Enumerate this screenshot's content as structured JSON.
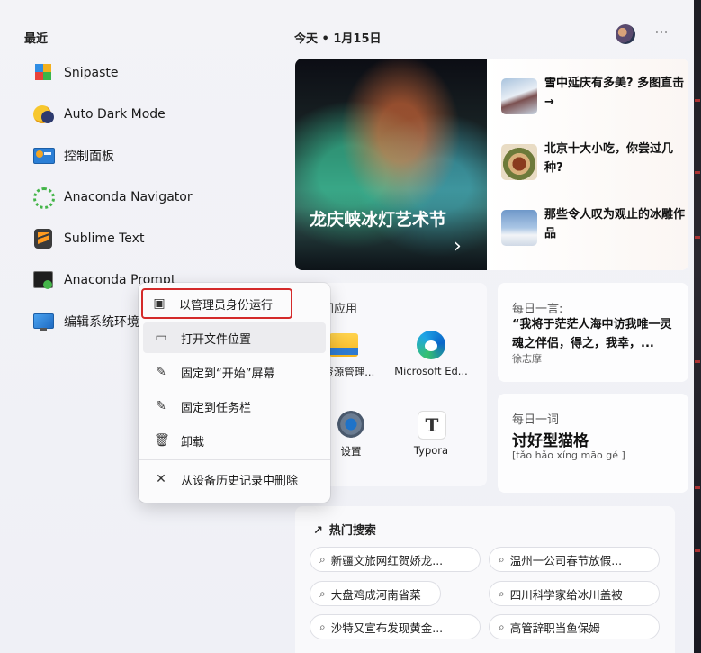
{
  "recent": {
    "title": "最近",
    "items": [
      {
        "label": "Snipaste",
        "icon": "snipaste-icon"
      },
      {
        "label": "Auto Dark Mode",
        "icon": "auto-dark-mode-icon"
      },
      {
        "label": "控制面板",
        "icon": "control-panel-icon"
      },
      {
        "label": "Anaconda Navigator",
        "icon": "anaconda-navigator-icon"
      },
      {
        "label": "Sublime Text",
        "icon": "sublime-text-icon"
      },
      {
        "label": "Anaconda Prompt",
        "icon": "anaconda-prompt-icon"
      },
      {
        "label": "编辑系统环境",
        "icon": "system-environment-icon"
      }
    ]
  },
  "header": {
    "today": "今天 • 1月15日",
    "more": "···"
  },
  "news": {
    "hero_title": "龙庆峡冰灯艺术节",
    "hero_arrow": "›",
    "items": [
      {
        "text": "雪中延庆有多美? 多图直击→"
      },
      {
        "text": "北京十大小吃，你尝过几种?"
      },
      {
        "text": "那些令人叹为观止的冰雕作品"
      }
    ]
  },
  "apps": {
    "title": "门应用",
    "items": [
      {
        "label": "件资源管理...",
        "icon": "file-explorer-icon"
      },
      {
        "label": "Microsoft Ed...",
        "icon": "edge-icon"
      },
      {
        "label": "设置",
        "icon": "settings-gear-icon"
      },
      {
        "label": "Typora",
        "icon": "typora-icon",
        "glyph": "T"
      }
    ]
  },
  "quote": {
    "caption": "每日一言:",
    "text": "“我将于茫茫人海中访我唯一灵魂之伴侣，得之，我幸，...",
    "author": "徐志摩"
  },
  "word": {
    "caption": "每日一词",
    "word": "讨好型猫格",
    "pinyin": "[tǎo hǎo xíng māo gé ]"
  },
  "hot": {
    "title": "热门搜索",
    "arrow": "↗",
    "chips": [
      "新疆文旅网红贺娇龙...",
      "温州一公司春节放假...",
      "大盘鸡成河南省菜",
      "四川科学家给冰川盖被",
      "沙特又宣布发现黄金...",
      "高管辞职当鱼保姆"
    ]
  },
  "context_menu": {
    "items": [
      {
        "label": "以管理员身份运行",
        "icon": "shield-run-icon",
        "glyph": "▣"
      },
      {
        "label": "打开文件位置",
        "icon": "folder-icon",
        "glyph": "▭"
      },
      {
        "label": "固定到“开始”屏幕",
        "icon": "pin-icon",
        "glyph": "✎"
      },
      {
        "label": "固定到任务栏",
        "icon": "pin-taskbar-icon",
        "glyph": "✎"
      },
      {
        "label": "卸载",
        "icon": "trash-icon",
        "glyph": "🗑"
      },
      {
        "label": "从设备历史记录中删除",
        "icon": "close-icon",
        "glyph": "✕"
      }
    ]
  },
  "colors": {
    "highlight_border": "#d42a2a",
    "accent": "#0067c0"
  }
}
